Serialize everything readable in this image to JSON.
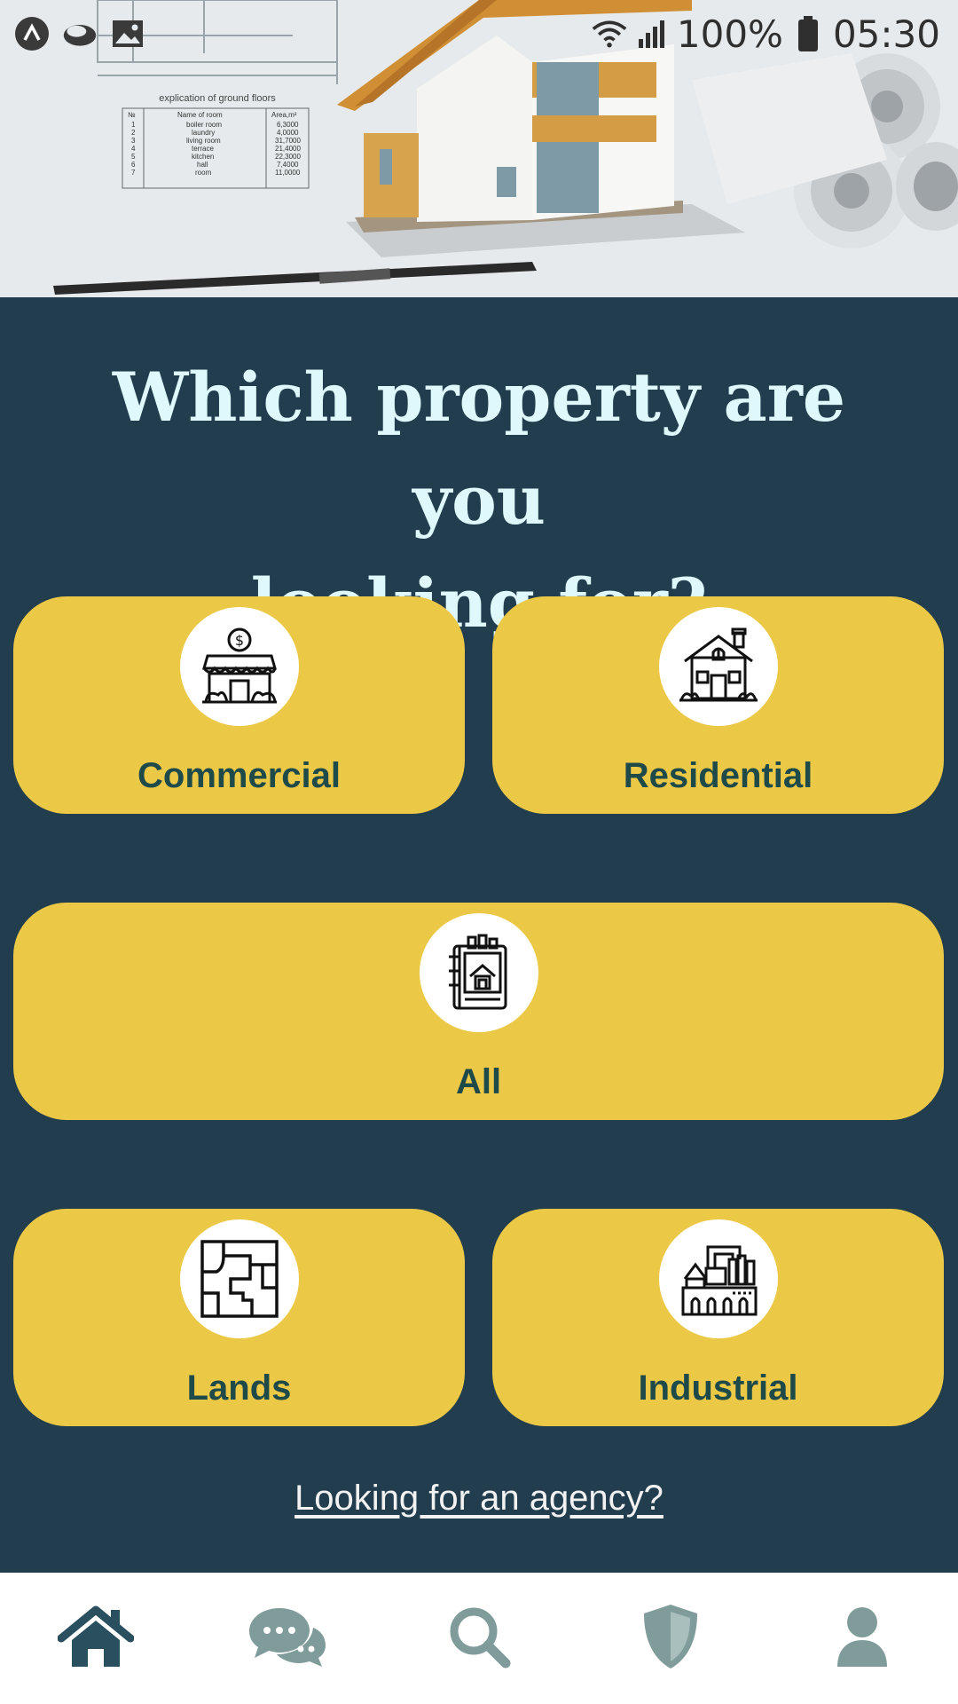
{
  "status_bar": {
    "battery": "100%",
    "time": "05:30",
    "left_icons": [
      "app-a-icon",
      "cloud-icon",
      "image-icon"
    ],
    "right_icons": [
      "wifi-icon",
      "signal-icon",
      "battery-icon"
    ]
  },
  "hero": {
    "table_title": "explication of ground floors",
    "table_headers": [
      "№",
      "Name of room",
      "Area,m²"
    ],
    "table_rows": [
      [
        "1",
        "boiler room",
        "6,3000"
      ],
      [
        "2",
        "laundry",
        "4,0000"
      ],
      [
        "3",
        "living room",
        "31,7000"
      ],
      [
        "4",
        "terrace",
        "21,4000"
      ],
      [
        "5",
        "kitchen",
        "22,3000"
      ],
      [
        "6",
        "hall",
        "7,4000"
      ],
      [
        "7",
        "room",
        "11,0000"
      ]
    ]
  },
  "heading": {
    "line1": "Which property are you",
    "line2": "looking for?"
  },
  "categories": {
    "commercial": {
      "label": "Commercial",
      "icon": "storefront-icon"
    },
    "residential": {
      "label": "Residential",
      "icon": "house-icon"
    },
    "all": {
      "label": "All",
      "icon": "property-catalog-icon"
    },
    "lands": {
      "label": "Lands",
      "icon": "floor-plan-icon"
    },
    "industrial": {
      "label": "Industrial",
      "icon": "factory-icon"
    }
  },
  "agency_link": " Looking for an agency?",
  "bottom_nav": [
    {
      "name": "home",
      "icon": "home-icon",
      "active": true
    },
    {
      "name": "chat",
      "icon": "chat-icon",
      "active": false
    },
    {
      "name": "search",
      "icon": "search-icon",
      "active": false
    },
    {
      "name": "shield",
      "icon": "shield-icon",
      "active": false
    },
    {
      "name": "profile",
      "icon": "user-icon",
      "active": false
    }
  ],
  "colors": {
    "background": "#223d4e",
    "card": "#ecc847",
    "card_label": "#1f4a4a",
    "heading": "#dff8fb",
    "nav_active": "#2a4f5f",
    "nav_inactive": "#7f9c9b"
  }
}
